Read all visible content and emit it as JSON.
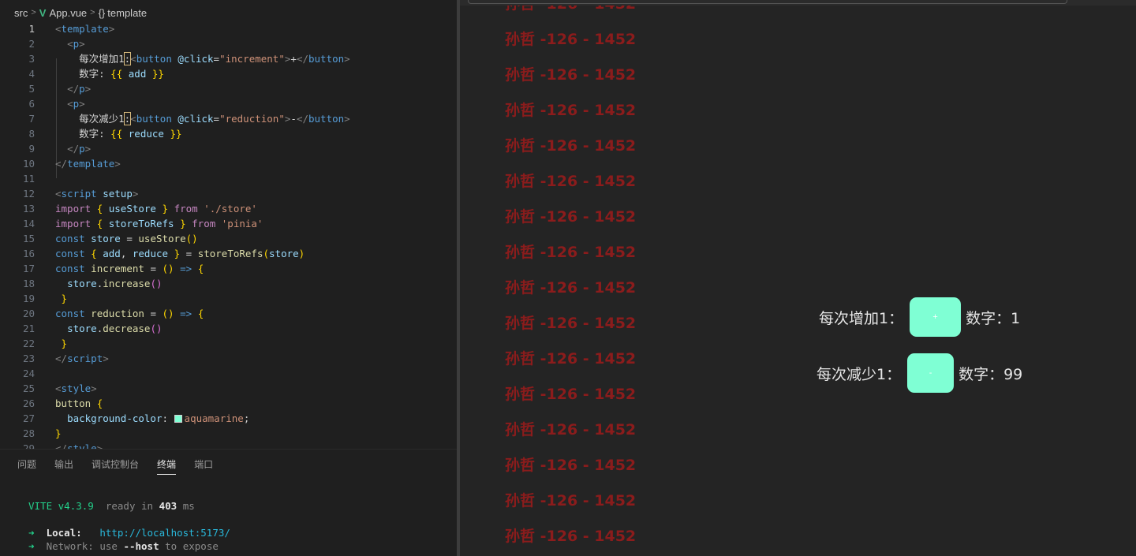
{
  "breadcrumb": {
    "folder": "src",
    "file": "App.vue",
    "symbol": "template"
  },
  "code_lines": [
    {
      "n": "1",
      "html": "<span class=\"tg\">&lt;</span><span class=\"tn\">template</span><span class=\"tg\">&gt;</span>"
    },
    {
      "n": "2",
      "html": "  <span class=\"tg\">&lt;</span><span class=\"tn\">p</span><span class=\"tg\">&gt;</span>"
    },
    {
      "n": "3",
      "html": "    <span class=\"tx\">每次增加1</span><span class=\"tx hl\">:</span><span class=\"tg\">&lt;</span><span class=\"tn\">button</span> <span class=\"at\">@click</span><span class=\"tx\">=</span><span class=\"st\">\"increment\"</span><span class=\"tg\">&gt;</span><span class=\"tx\">+</span><span class=\"tg\">&lt;/</span><span class=\"tn\">button</span><span class=\"tg\">&gt;</span>"
    },
    {
      "n": "4",
      "html": "    <span class=\"tx\">数字: </span><span class=\"br\">{{</span> <span class=\"at\">add</span> <span class=\"br\">}}</span>"
    },
    {
      "n": "5",
      "html": "  <span class=\"tg\">&lt;/</span><span class=\"tn\">p</span><span class=\"tg\">&gt;</span>"
    },
    {
      "n": "6",
      "html": "  <span class=\"tg\">&lt;</span><span class=\"tn\">p</span><span class=\"tg\">&gt;</span>"
    },
    {
      "n": "7",
      "html": "    <span class=\"tx\">每次减少1</span><span class=\"tx hl\">:</span><span class=\"tg\">&lt;</span><span class=\"tn\">button</span> <span class=\"at\">@click</span><span class=\"tx\">=</span><span class=\"st\">\"reduction\"</span><span class=\"tg\">&gt;</span><span class=\"tx\">-</span><span class=\"tg\">&lt;/</span><span class=\"tn\">button</span><span class=\"tg\">&gt;</span>"
    },
    {
      "n": "8",
      "html": "    <span class=\"tx\">数字: </span><span class=\"br\">{{</span> <span class=\"at\">reduce</span> <span class=\"br\">}}</span>"
    },
    {
      "n": "9",
      "html": "  <span class=\"tg\">&lt;/</span><span class=\"tn\">p</span><span class=\"tg\">&gt;</span>"
    },
    {
      "n": "10",
      "html": "<span class=\"tg\">&lt;/</span><span class=\"tn\">template</span><span class=\"tg\">&gt;</span>"
    },
    {
      "n": "11",
      "html": ""
    },
    {
      "n": "12",
      "html": "<span class=\"tg\">&lt;</span><span class=\"tn\">script</span> <span class=\"at\">setup</span><span class=\"tg\">&gt;</span>"
    },
    {
      "n": "13",
      "html": "<span class=\"kw\">import</span> <span class=\"br\">{</span> <span class=\"at\">useStore</span> <span class=\"br\">}</span> <span class=\"kw\">from</span> <span class=\"st\">'./store'</span>"
    },
    {
      "n": "14",
      "html": "<span class=\"kw\">import</span> <span class=\"br\">{</span> <span class=\"at\">storeToRefs</span> <span class=\"br\">}</span> <span class=\"kw\">from</span> <span class=\"st\">'pinia'</span>"
    },
    {
      "n": "15",
      "html": "<span class=\"tn\">const</span> <span class=\"at\">store</span> <span class=\"tx\">=</span> <span class=\"fn\">useStore</span><span class=\"br\">()</span>"
    },
    {
      "n": "16",
      "html": "<span class=\"tn\">const</span> <span class=\"br\">{</span> <span class=\"at\">add</span><span class=\"tx\">,</span> <span class=\"at\">reduce</span> <span class=\"br\">}</span> <span class=\"tx\">=</span> <span class=\"fn\">storeToRefs</span><span class=\"br\">(</span><span class=\"at\">store</span><span class=\"br\">)</span>"
    },
    {
      "n": "17",
      "html": "<span class=\"tn\">const</span> <span class=\"fn\">increment</span> <span class=\"tx\">=</span> <span class=\"br\">()</span> <span class=\"tn\">=&gt;</span> <span class=\"br\">{</span>"
    },
    {
      "n": "18",
      "html": "  <span class=\"at\">store</span><span class=\"tx\">.</span><span class=\"fn\">increase</span><span class=\"br2\">()</span>"
    },
    {
      "n": "19",
      "html": " <span class=\"br\">}</span>"
    },
    {
      "n": "20",
      "html": "<span class=\"tn\">const</span> <span class=\"fn\">reduction</span> <span class=\"tx\">=</span> <span class=\"br\">()</span> <span class=\"tn\">=&gt;</span> <span class=\"br\">{</span>"
    },
    {
      "n": "21",
      "html": "  <span class=\"at\">store</span><span class=\"tx\">.</span><span class=\"fn\">decrease</span><span class=\"br2\">()</span>"
    },
    {
      "n": "22",
      "html": " <span class=\"br\">}</span>"
    },
    {
      "n": "23",
      "html": "<span class=\"tg\">&lt;/</span><span class=\"tn\">script</span><span class=\"tg\">&gt;</span>"
    },
    {
      "n": "24",
      "html": ""
    },
    {
      "n": "25",
      "html": "<span class=\"tg\">&lt;</span><span class=\"tn\">style</span><span class=\"tg\">&gt;</span>"
    },
    {
      "n": "26",
      "html": "<span class=\"fn\">button</span> <span class=\"br\">{</span>"
    },
    {
      "n": "27",
      "html": "  <span class=\"at\">background-color</span><span class=\"tx\">: </span><span class=\"swatch\"></span><span class=\"st\">aquamarine</span><span class=\"tx\">;</span>"
    },
    {
      "n": "28",
      "html": "<span class=\"br\">}</span>"
    },
    {
      "n": "29",
      "html": "<span class=\"tg\">&lt;/</span><span class=\"tn\">style</span><span class=\"tg\">&gt;</span>"
    }
  ],
  "panel": {
    "tabs": [
      "问题",
      "输出",
      "调试控制台",
      "终端",
      "端口"
    ],
    "active_tab": "终端"
  },
  "terminal": {
    "vite": "VITE",
    "version": "v4.3.9",
    "ready": "ready in",
    "ms": "403",
    "ms_unit": "ms",
    "local_label": "Local:",
    "local_url": "http://localhost:5173/",
    "network_label": "Network:",
    "network_text_1": "use",
    "network_flag": "--host",
    "network_text_2": "to expose"
  },
  "preview": {
    "watermark_text": "孙哲 -126 - 1452",
    "watermark_count": 16,
    "increment_label": "每次增加1：",
    "increment_button": "+",
    "add_label": "数字：1",
    "reduction_label": "每次减少1：",
    "reduction_button": "-",
    "reduce_label": "数字：99",
    "button_color": "#7fffd4",
    "watermark_color": "#8b1c1c"
  }
}
